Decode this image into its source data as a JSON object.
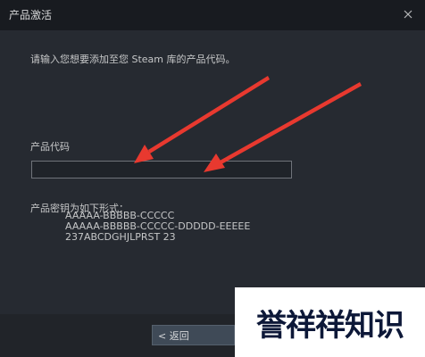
{
  "window": {
    "title": "产品激活"
  },
  "main": {
    "instruction": "请输入您想要添加至您 Steam 库的产品代码。",
    "field_label": "产品代码",
    "code_value": "",
    "formats_label": "产品密钥为如下形式：",
    "formats": [
      "AAAAA-BBBBB-CCCCC",
      "AAAAA-BBBBB-CCCCC-DDDDD-EEEEE",
      "237ABCDGHJLPRST 23"
    ]
  },
  "footer": {
    "back_label": "< 返回"
  },
  "watermark": {
    "text": "誉祥祥知识"
  },
  "colors": {
    "titlebar": "#181b20",
    "content_bg": "#262a31",
    "text": "#c6c7c8",
    "arrow": "#e8392f",
    "button_bg": "#3f4a57",
    "watermark_text": "#0d1838"
  }
}
